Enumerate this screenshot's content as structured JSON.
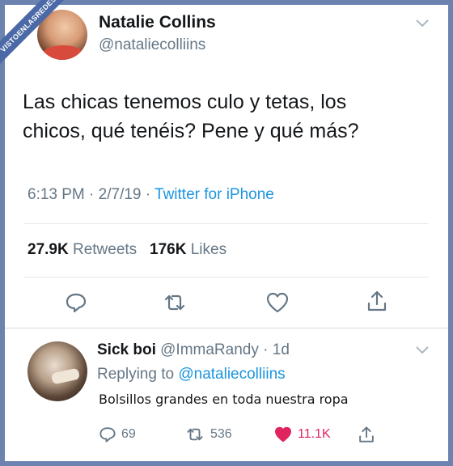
{
  "watermark": "VISTOENLASREDES",
  "tweet": {
    "author_name": "Natalie Collins",
    "author_handle": "@nataliecolliins",
    "text_line1": "Las chicas tenemos culo y tetas, los",
    "text_line2": "chicos, qué tenéis? Pene y qué más?",
    "time": "6:13 PM",
    "sep": "·",
    "date": "2/7/19",
    "source": "Twitter for iPhone",
    "retweets_count": "27.9K",
    "retweets_label": "Retweets",
    "likes_count": "176K",
    "likes_label": "Likes",
    "icons": [
      "reply-icon",
      "retweet-icon",
      "like-icon",
      "share-icon",
      "chevron-down-icon"
    ]
  },
  "reply": {
    "author_name": "Sick boi",
    "author_handle": "@ImmaRandy",
    "age": "· 1d",
    "replying_prefix": "Replying to",
    "replying_handle": "@nataliecolliins",
    "text": "Bolsillos grandes en toda nuestra ropa",
    "reply_count": "69",
    "retweet_count": "536",
    "like_count": "11.1K"
  },
  "colors": {
    "frame": "#6c83b0",
    "link": "#1b95e0",
    "muted": "#657786",
    "like_active": "#e0245e"
  }
}
